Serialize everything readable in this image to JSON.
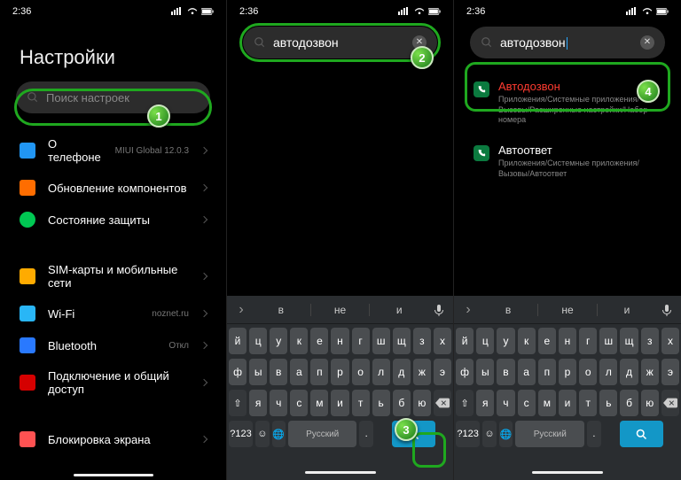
{
  "status": {
    "time": "2:36"
  },
  "phone1": {
    "title": "Настройки",
    "search_placeholder": "Поиск настроек",
    "items": {
      "about": {
        "label": "О телефоне",
        "sub": "MIUI Global 12.0.3"
      },
      "update": {
        "label": "Обновление компонентов"
      },
      "security": {
        "label": "Состояние защиты"
      },
      "sim": {
        "label": "SIM-карты и мобильные сети"
      },
      "wifi": {
        "label": "Wi-Fi",
        "sub": "noznet.ru"
      },
      "bt": {
        "label": "Bluetooth",
        "sub": "Откл"
      },
      "share": {
        "label": "Подключение и общий доступ"
      },
      "lock": {
        "label": "Блокировка экрана"
      }
    }
  },
  "phone2": {
    "search_value": "автодозвон",
    "suggestions": [
      "в",
      "не",
      "и"
    ],
    "keyboard": {
      "row1": [
        "й",
        "ц",
        "у",
        "к",
        "е",
        "н",
        "г",
        "ш",
        "щ",
        "з",
        "х"
      ],
      "row2": [
        "ф",
        "ы",
        "в",
        "а",
        "п",
        "р",
        "о",
        "л",
        "д",
        "ж",
        "э"
      ],
      "row3": [
        "я",
        "ч",
        "с",
        "м",
        "и",
        "т",
        "ь",
        "б",
        "ю"
      ],
      "shift": "⇧",
      "space": "Русский",
      "fn": "?123"
    }
  },
  "phone3": {
    "search_value": "автодозвон",
    "results": [
      {
        "title": "Автодозвон",
        "path": "Приложения/Системные приложения/Вызовы/Расширенные настройки/Набор номера",
        "highlight": true
      },
      {
        "title": "Автоответ",
        "path": "Приложения/Системные приложения/Вызовы/Автоответ",
        "highlight": false
      }
    ],
    "suggestions": [
      "в",
      "не",
      "и"
    ]
  },
  "badges": {
    "b1": "1",
    "b2": "2",
    "b3": "3",
    "b4": "4"
  }
}
